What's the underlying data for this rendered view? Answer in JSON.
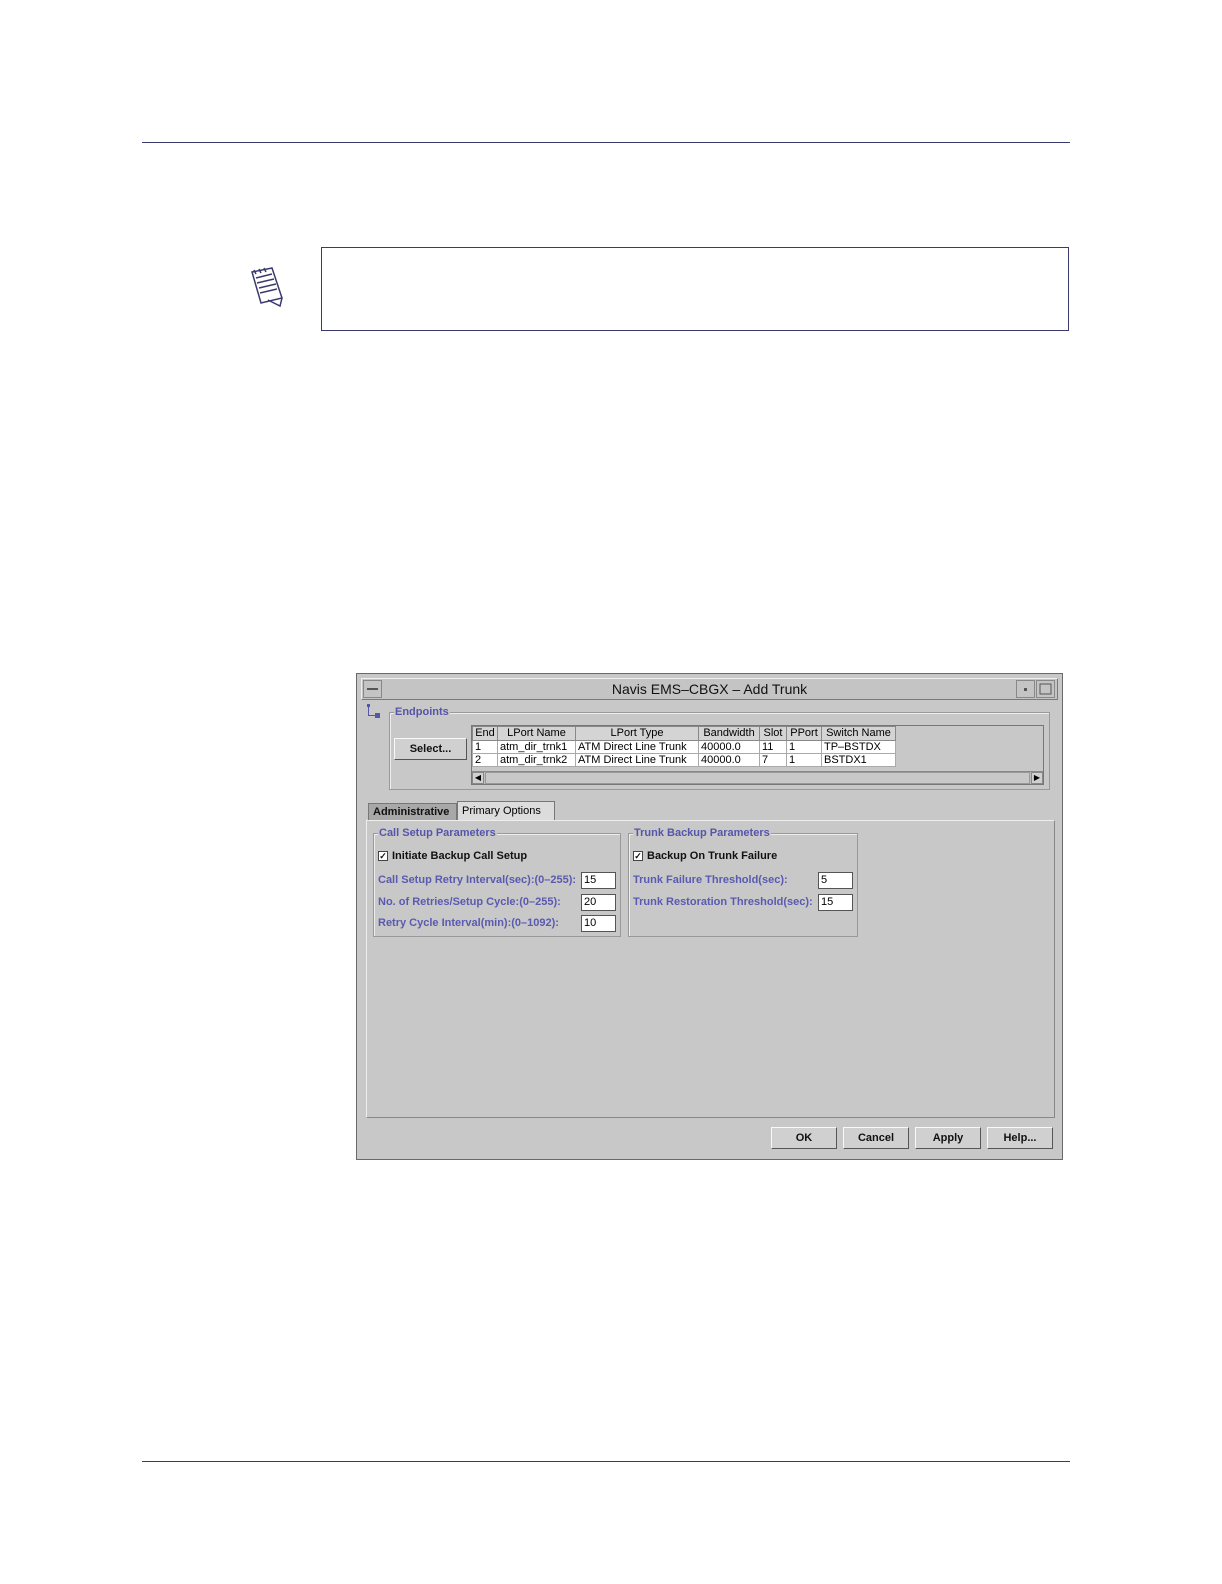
{
  "dialog": {
    "title": "Navis EMS–CBGX – Add Trunk",
    "endpoints": {
      "group_title": "Endpoints",
      "select_label": "Select...",
      "columns": [
        "End",
        "LPort Name",
        "LPort Type",
        "Bandwidth",
        "Slot",
        "PPort",
        "Switch Name"
      ],
      "rows": [
        [
          "1",
          "atm_dir_trnk1",
          "ATM Direct Line Trunk",
          "40000.0",
          "11",
          "1",
          "TP–BSTDX"
        ],
        [
          "2",
          "atm_dir_trnk2",
          "ATM Direct Line Trunk",
          "40000.0",
          "7",
          "1",
          "BSTDX1"
        ]
      ]
    },
    "tabs": [
      {
        "label": "Administrative"
      },
      {
        "label": "Primary Options"
      }
    ],
    "call_setup": {
      "group_title": "Call Setup Parameters",
      "initiate_label": "Initiate Backup Call Setup",
      "retry_interval_label": "Call Setup Retry Interval(sec):(0–255):",
      "retry_interval_value": "15",
      "retries_label": "No. of Retries/Setup Cycle:(0–255):",
      "retries_value": "20",
      "cycle_interval_label": "Retry Cycle Interval(min):(0–1092):",
      "cycle_interval_value": "10"
    },
    "trunk_backup": {
      "group_title": "Trunk Backup Parameters",
      "backup_label": "Backup On Trunk Failure",
      "failure_label": "Trunk Failure Threshold(sec):",
      "failure_value": "5",
      "restoration_label": "Trunk Restoration Threshold(sec):",
      "restoration_value": "15"
    },
    "buttons": {
      "ok": "OK",
      "cancel": "Cancel",
      "apply": "Apply",
      "help": "Help..."
    }
  },
  "icons": {
    "note": "note-icon",
    "tree": "tree-icon"
  }
}
